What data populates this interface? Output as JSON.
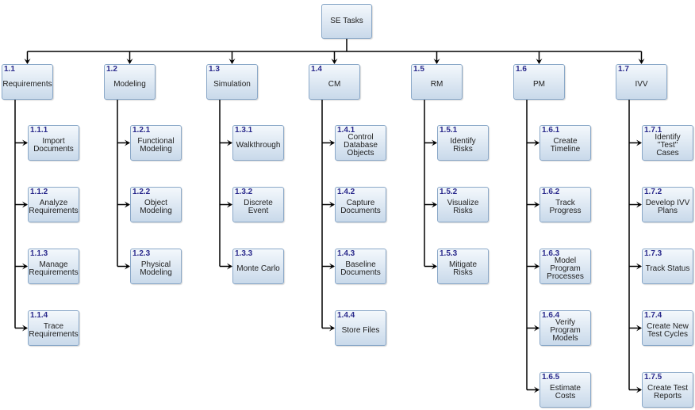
{
  "root": {
    "label": "SE Tasks"
  },
  "colors": {
    "id_text": "#2a2a8c",
    "box_border": "#8aa8c8",
    "line": "#000000"
  },
  "branches": [
    {
      "id": "1.1",
      "label": "Requirements",
      "children": [
        {
          "id": "1.1.1",
          "label": "Import\nDocuments"
        },
        {
          "id": "1.1.2",
          "label": "Analyze\nRequirements"
        },
        {
          "id": "1.1.3",
          "label": "Manage\nRequirements"
        },
        {
          "id": "1.1.4",
          "label": "Trace\nRequirements"
        }
      ]
    },
    {
      "id": "1.2",
      "label": "Modeling",
      "children": [
        {
          "id": "1.2.1",
          "label": "Functional\nModeling"
        },
        {
          "id": "1.2.2",
          "label": "Object\nModeling"
        },
        {
          "id": "1.2.3",
          "label": "Physical\nModeling"
        }
      ]
    },
    {
      "id": "1.3",
      "label": "Simulation",
      "children": [
        {
          "id": "1.3.1",
          "label": "Walkthrough"
        },
        {
          "id": "1.3.2",
          "label": "Discrete Event"
        },
        {
          "id": "1.3.3",
          "label": "Monte Carlo"
        }
      ]
    },
    {
      "id": "1.4",
      "label": "CM",
      "children": [
        {
          "id": "1.4.1",
          "label": "Control\nDatabase\nObjects"
        },
        {
          "id": "1.4.2",
          "label": "Capture\nDocuments"
        },
        {
          "id": "1.4.3",
          "label": "Baseline\nDocuments"
        },
        {
          "id": "1.4.4",
          "label": "Store Files"
        }
      ]
    },
    {
      "id": "1.5",
      "label": "RM",
      "children": [
        {
          "id": "1.5.1",
          "label": "Identify Risks"
        },
        {
          "id": "1.5.2",
          "label": "Visualize\nRisks"
        },
        {
          "id": "1.5.3",
          "label": "Mitigate Risks"
        }
      ]
    },
    {
      "id": "1.6",
      "label": "PM",
      "children": [
        {
          "id": "1.6.1",
          "label": "Create\nTimeline"
        },
        {
          "id": "1.6.2",
          "label": "Track\nProgress"
        },
        {
          "id": "1.6.3",
          "label": "Model\nProgram\nProcesses"
        },
        {
          "id": "1.6.4",
          "label": "Verify\nProgram\nModels"
        },
        {
          "id": "1.6.5",
          "label": "Estimate\nCosts"
        }
      ]
    },
    {
      "id": "1.7",
      "label": "IVV",
      "children": [
        {
          "id": "1.7.1",
          "label": "Identify \"Test\"\nCases"
        },
        {
          "id": "1.7.2",
          "label": "Develop IVV\nPlans"
        },
        {
          "id": "1.7.3",
          "label": "Track Status"
        },
        {
          "id": "1.7.4",
          "label": "Create New\nTest Cycles"
        },
        {
          "id": "1.7.5",
          "label": "Create Test\nReports"
        }
      ]
    }
  ]
}
